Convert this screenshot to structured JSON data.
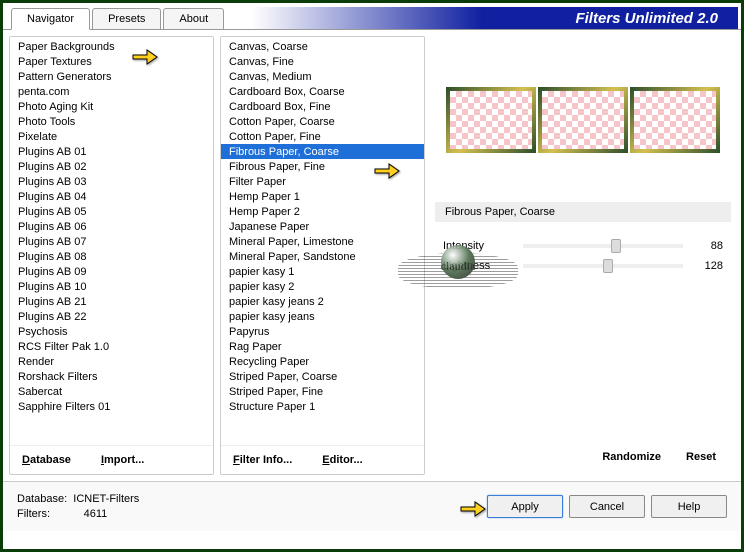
{
  "title": "Filters Unlimited 2.0",
  "tabs": [
    "Navigator",
    "Presets",
    "About"
  ],
  "active_tab": 0,
  "categories": {
    "items": [
      "Paper Backgrounds",
      "Paper Textures",
      "Pattern Generators",
      "penta.com",
      "Photo Aging Kit",
      "Photo Tools",
      "Pixelate",
      "Plugins AB 01",
      "Plugins AB 02",
      "Plugins AB 03",
      "Plugins AB 04",
      "Plugins AB 05",
      "Plugins AB 06",
      "Plugins AB 07",
      "Plugins AB 08",
      "Plugins AB 09",
      "Plugins AB 10",
      "Plugins AB 21",
      "Plugins AB 22",
      "Psychosis",
      "RCS Filter Pak 1.0",
      "Render",
      "Rorshack Filters",
      "Sabercat",
      "Sapphire Filters 01"
    ],
    "selected": "Paper Textures",
    "buttons": {
      "database": "Database",
      "import": "Import...",
      "db_u": "D",
      "im_u": "I"
    }
  },
  "filters": {
    "items": [
      "Canvas, Coarse",
      "Canvas, Fine",
      "Canvas, Medium",
      "Cardboard Box, Coarse",
      "Cardboard Box, Fine",
      "Cotton Paper, Coarse",
      "Cotton Paper, Fine",
      "Fibrous Paper, Coarse",
      "Fibrous Paper, Fine",
      "Filter Paper",
      "Hemp Paper 1",
      "Hemp Paper 2",
      "Japanese Paper",
      "Mineral Paper, Limestone",
      "Mineral Paper, Sandstone",
      "papier kasy 1",
      "papier kasy 2",
      "papier kasy jeans 2",
      "papier kasy jeans",
      "Papyrus",
      "Rag Paper",
      "Recycling Paper",
      "Striped Paper, Coarse",
      "Striped Paper, Fine",
      "Structure Paper 1"
    ],
    "selected": "Fibrous Paper, Coarse",
    "buttons": {
      "filter_info": "Filter Info...",
      "editor": "Editor...",
      "fi_u": "F",
      "ed_u": "E"
    }
  },
  "preview": {
    "filter_name": "Fibrous Paper, Coarse"
  },
  "params": [
    {
      "name": "Intensity",
      "value": 88,
      "pos": 55
    },
    {
      "name": "Lightness",
      "value": 128,
      "pos": 50
    }
  ],
  "right_buttons": {
    "randomize": "Randomize",
    "reset": "Reset"
  },
  "footer": {
    "db_label": "Database:",
    "db_value": "ICNET-Filters",
    "filters_label": "Filters:",
    "filters_value": "4611"
  },
  "footer_buttons": {
    "apply": "Apply",
    "cancel": "Cancel",
    "help": "Help"
  },
  "watermark": "claudia"
}
